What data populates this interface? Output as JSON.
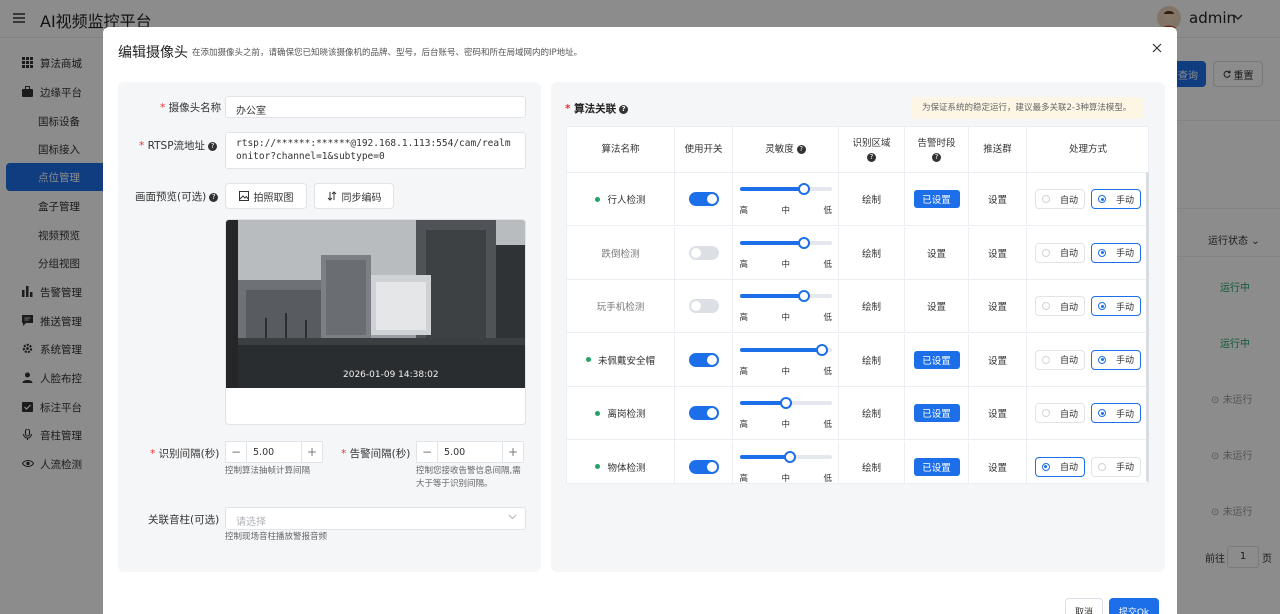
{
  "app": {
    "title": "AI视频监控平台",
    "user": "admin"
  },
  "sidebar": {
    "items": [
      {
        "label": "算法商城",
        "icon": "grid-icon"
      },
      {
        "label": "边缘平台",
        "icon": "briefcase-icon"
      },
      {
        "label": "国标设备",
        "icon": ""
      },
      {
        "label": "国标接入",
        "icon": ""
      },
      {
        "label": "点位管理",
        "icon": ""
      },
      {
        "label": "盒子管理",
        "icon": ""
      },
      {
        "label": "视频预览",
        "icon": ""
      },
      {
        "label": "分组视图",
        "icon": ""
      },
      {
        "label": "告警管理",
        "icon": "bar-chart-icon"
      },
      {
        "label": "推送管理",
        "icon": "message-icon"
      },
      {
        "label": "系统管理",
        "icon": "gear-icon"
      },
      {
        "label": "人脸布控",
        "icon": "user-icon"
      },
      {
        "label": "标注平台",
        "icon": "checkbox-icon"
      },
      {
        "label": "音柱管理",
        "icon": "mic-icon"
      },
      {
        "label": "人流检测",
        "icon": "eye-icon"
      }
    ]
  },
  "background": {
    "query_label": "查询",
    "reset_label": "重置",
    "status_header": "运行状态",
    "statuses": [
      "运行中",
      "运行中",
      "未运行",
      "未运行",
      "未运行"
    ],
    "page_prefix": "前往",
    "page_value": "1",
    "page_suffix": "页"
  },
  "modal": {
    "title": "编辑摄像头",
    "hint": "在添加摄像头之前，请确保您已知晓该摄像机的品牌、型号，后台账号、密码和所在局域网内的IP地址。",
    "form": {
      "name_label": "摄像头名称",
      "name_value": "办公室",
      "rtsp_label": "RTSP流地址",
      "rtsp_value": "rtsp://******:******@192.168.1.113:554/cam/realmonitor?channel=1&subtype=0",
      "preview_label": "画面预览(可选)",
      "snapshot_button": "拍照取图",
      "sync_button": "同步编码",
      "camera_timestamp": "2026-01-09 14:38:02",
      "interval_label": "识别间隔(秒)",
      "interval_value": "5.00",
      "interval_hint": "控制算法抽帧计算间隔",
      "alarm_label": "告警间隔(秒)",
      "alarm_value": "5.00",
      "alarm_hint": "控制您接收告警信息间隔,需大于等于识别间隔。",
      "speaker_label": "关联音柱(可选)",
      "speaker_placeholder": "请选择",
      "speaker_hint": "控制现场音柱播放警报音频"
    },
    "algo": {
      "title": "算法关联",
      "tip": "为保证系统的稳定运行，建议最多关联2-3种算法模型。",
      "headers": [
        "算法名称",
        "使用开关",
        "灵敏度",
        "识别区域",
        "告警时段",
        "推送群",
        "处理方式"
      ],
      "sens_labels": [
        "高",
        "中",
        "低"
      ],
      "rows": [
        {
          "name": "行人检测",
          "enabled": true,
          "sensitivity": 0.7,
          "region": "绘制",
          "period": "已设置",
          "period_set": true,
          "push": "设置",
          "auto": "自动",
          "manual": "手动",
          "mode": "manual"
        },
        {
          "name": "跌倒检测",
          "enabled": false,
          "sensitivity": 0.7,
          "region": "绘制",
          "period": "设置",
          "period_set": false,
          "push": "设置",
          "auto": "自动",
          "manual": "手动",
          "mode": "manual"
        },
        {
          "name": "玩手机检测",
          "enabled": false,
          "sensitivity": 0.7,
          "region": "绘制",
          "period": "设置",
          "period_set": false,
          "push": "设置",
          "auto": "自动",
          "manual": "手动",
          "mode": "manual"
        },
        {
          "name": "未佩戴安全帽",
          "enabled": true,
          "sensitivity": 0.9,
          "region": "绘制",
          "period": "已设置",
          "period_set": true,
          "push": "设置",
          "auto": "自动",
          "manual": "手动",
          "mode": "manual"
        },
        {
          "name": "离岗检测",
          "enabled": true,
          "sensitivity": 0.5,
          "region": "绘制",
          "period": "已设置",
          "period_set": true,
          "push": "设置",
          "auto": "自动",
          "manual": "手动",
          "mode": "manual"
        },
        {
          "name": "物体检测",
          "enabled": true,
          "sensitivity": 0.55,
          "region": "绘制",
          "period": "已设置",
          "period_set": true,
          "push": "设置",
          "auto": "自动",
          "manual": "手动",
          "mode": "auto"
        }
      ]
    },
    "cancel_label": "取消",
    "submit_label": "提交Ok"
  }
}
